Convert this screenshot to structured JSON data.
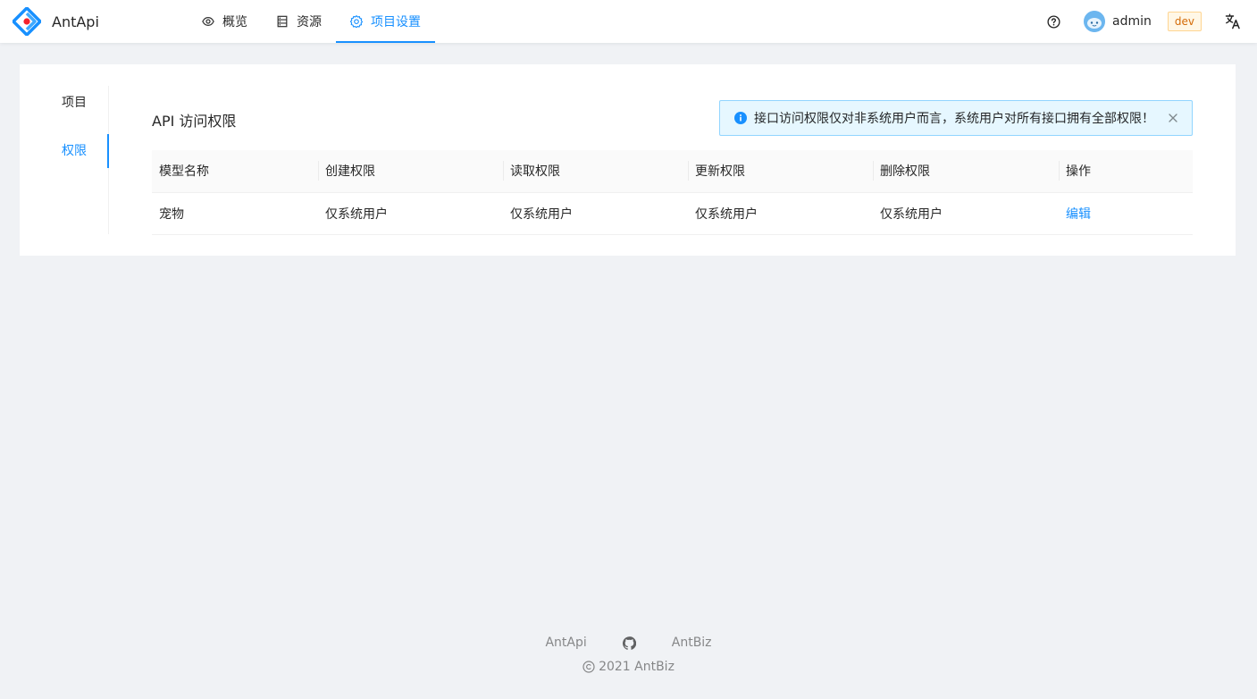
{
  "app": {
    "name": "AntApi",
    "brand_color": "#1890ff"
  },
  "header": {
    "nav": [
      {
        "label": "概览",
        "icon": "eye-icon"
      },
      {
        "label": "资源",
        "icon": "database-icon"
      },
      {
        "label": "项目设置",
        "icon": "gear-icon",
        "active": true
      }
    ],
    "user": {
      "name": "admin",
      "avatar": "avatar-icon"
    },
    "env_tag": "dev",
    "icons": {
      "help": "question-circle-icon",
      "language": "translation-icon"
    }
  },
  "side_menu": {
    "items": [
      {
        "label": "项目"
      },
      {
        "label": "权限",
        "active": true
      }
    ]
  },
  "main": {
    "title": "API 访问权限",
    "alert": {
      "text": "接口访问权限仅对非系统用户而言，系统用户对所有接口拥有全部权限！",
      "icon": "info-circle-icon"
    },
    "table": {
      "columns": [
        "模型名称",
        "创建权限",
        "读取权限",
        "更新权限",
        "删除权限",
        "操作"
      ],
      "rows": [
        {
          "name": "宠物",
          "create": "仅系统用户",
          "read": "仅系统用户",
          "update": "仅系统用户",
          "delete": "仅系统用户",
          "action": "编辑"
        }
      ]
    }
  },
  "footer": {
    "links": [
      "AntApi",
      "AntBiz"
    ],
    "github_icon": "github-icon",
    "copyright": "2021 AntBiz"
  }
}
